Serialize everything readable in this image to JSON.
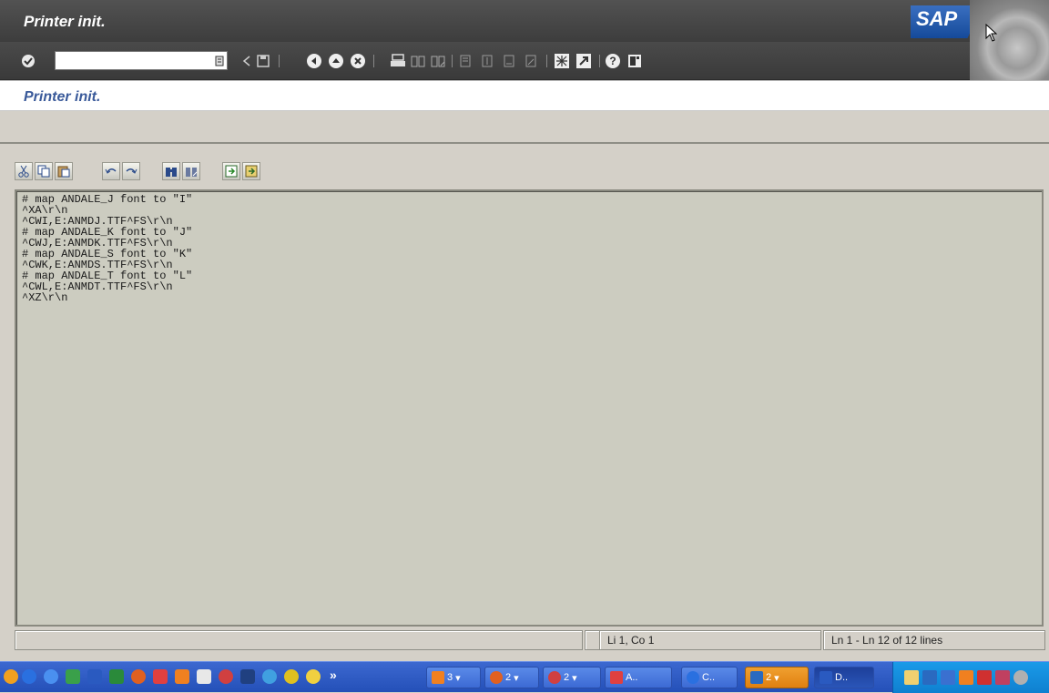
{
  "window": {
    "title": "Printer init.",
    "logo_text": "SAP"
  },
  "toolbar": {
    "command_field_value": "",
    "icons": [
      "enter-icon",
      "command-menu-icon",
      "back-icon",
      "save-icon",
      "back-circle-icon",
      "exit-icon",
      "cancel-icon",
      "print-icon",
      "find-icon",
      "find-next-icon",
      "first-page-icon",
      "previous-page-icon",
      "next-page-icon",
      "last-page-icon",
      "create-session-icon",
      "shortcut-icon",
      "help-icon",
      "layout-menu-icon"
    ]
  },
  "screen": {
    "title": "Printer init."
  },
  "editor_toolbar": {
    "icons": [
      "cut-icon",
      "copy-icon",
      "paste-icon",
      "undo-icon",
      "redo-icon",
      "find-icon",
      "find-next-icon",
      "upload-icon",
      "download-icon"
    ]
  },
  "editor": {
    "lines": [
      "# map ANDALE_J font to \"I\"",
      "^XA\\r\\n",
      "^CWI,E:ANMDJ.TTF^FS\\r\\n",
      "# map ANDALE_K font to \"J\"",
      "^CWJ,E:ANMDK.TTF^FS\\r\\n",
      "# map ANDALE_S font to \"K\"",
      "^CWK,E:ANMDS.TTF^FS\\r\\n",
      "# map ANDALE_T font to \"L\"",
      "^CWL,E:ANMDT.TTF^FS\\r\\n",
      "^XZ\\r\\n"
    ]
  },
  "statusbar": {
    "message": "",
    "cursor_position": "Li 1, Co 1",
    "line_range": "Ln 1 - Ln 12 of 12 lines"
  },
  "taskbar": {
    "overflow": "»",
    "tasks": [
      {
        "label": "3",
        "icon": "clock-icon"
      },
      {
        "label": "2",
        "icon": "firefox-icon"
      },
      {
        "label": "2",
        "icon": "network-icon"
      },
      {
        "label": "A..",
        "icon": "acrobat-icon"
      },
      {
        "label": "C..",
        "icon": "ie-icon"
      },
      {
        "label": "2",
        "icon": "sap-icon"
      },
      {
        "label": "D..",
        "icon": "word-icon"
      }
    ]
  }
}
